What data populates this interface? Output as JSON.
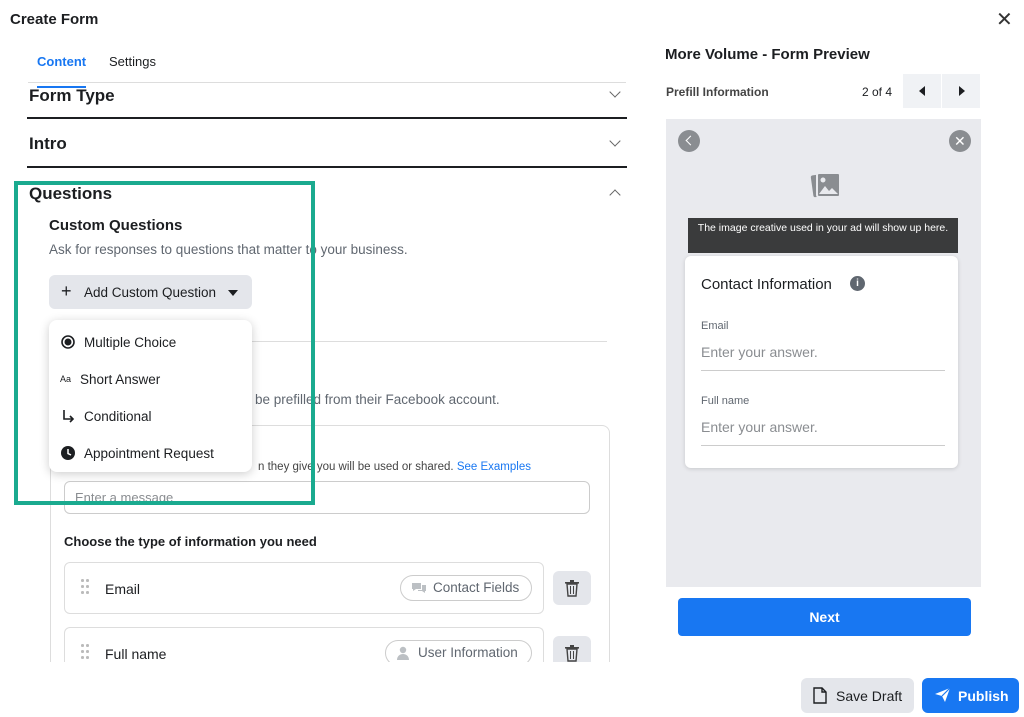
{
  "dialog": {
    "title": "Create Form",
    "close_icon": "close-icon"
  },
  "tabs": [
    {
      "label": "Content",
      "active": true
    },
    {
      "label": "Settings",
      "active": false
    }
  ],
  "sections": {
    "form_type": "Form Type",
    "intro": "Intro",
    "questions": "Questions"
  },
  "custom_questions": {
    "title": "Custom Questions",
    "description": "Ask for responses to questions that matter to your business.",
    "add_button": "Add Custom Question",
    "menu": [
      {
        "label": "Multiple Choice",
        "icon": "radio-icon"
      },
      {
        "label": "Short Answer",
        "icon": "text-icon"
      },
      {
        "label": "Conditional",
        "icon": "branch-icon"
      },
      {
        "label": "Appointment Request",
        "icon": "clock-icon"
      }
    ]
  },
  "prefill": {
    "description_visible": "be prefilled from their Facebook account.",
    "note_visible": "n they give you will be used or shared.",
    "see_examples": "See Examples",
    "message_placeholder": "Enter a message",
    "choose_label": "Choose the type of information you need",
    "fields": [
      {
        "label": "Email",
        "tag": "Contact Fields",
        "tag_icon": "chat-icon"
      },
      {
        "label": "Full name",
        "tag": "User Information",
        "tag_icon": "person-icon"
      }
    ]
  },
  "preview": {
    "title": "More Volume - Form Preview",
    "section": "Prefill Information",
    "page": "2 of 4",
    "tooltip": "The image creative used in your ad will show up here.",
    "card_title": "Contact Information",
    "fields": [
      {
        "label": "Email",
        "placeholder": "Enter your answer."
      },
      {
        "label": "Full name",
        "placeholder": "Enter your answer."
      }
    ],
    "next_button": "Next"
  },
  "footer": {
    "save_draft": "Save Draft",
    "publish": "Publish"
  },
  "colors": {
    "accent": "#1877f2",
    "highlight": "#1aaa8f"
  }
}
